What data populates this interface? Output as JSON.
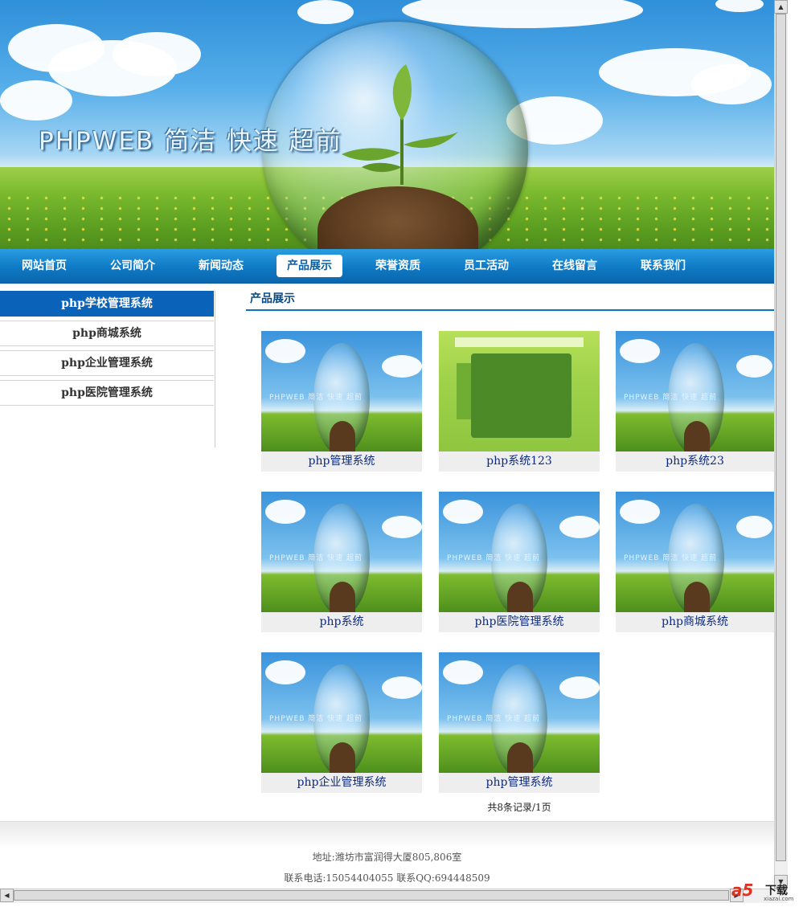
{
  "banner": {
    "title": "PHPWEB 简洁 快速 超前"
  },
  "nav": {
    "items": [
      {
        "label": "网站首页"
      },
      {
        "label": "公司简介"
      },
      {
        "label": "新闻动态"
      },
      {
        "label": "产品展示",
        "active": true
      },
      {
        "label": "荣誉资质"
      },
      {
        "label": "员工活动"
      },
      {
        "label": "在线留言"
      },
      {
        "label": "联系我们"
      }
    ]
  },
  "sidebar": {
    "items": [
      {
        "label": "php学校管理系统",
        "active": true
      },
      {
        "label": "php商城系统"
      },
      {
        "label": "php企业管理系统"
      },
      {
        "label": "php医院管理系统"
      }
    ]
  },
  "content": {
    "title": "产品展示",
    "products": [
      {
        "label": "php管理系统"
      },
      {
        "label": "php系统123"
      },
      {
        "label": "php系统23"
      },
      {
        "label": "php系统"
      },
      {
        "label": "php医院管理系统"
      },
      {
        "label": "php商城系统"
      },
      {
        "label": "php企业管理系统"
      },
      {
        "label": "php管理系统"
      }
    ],
    "pager": "共8条记录/1页"
  },
  "footer": {
    "address": "地址:潍坊市富润得大厦805,806室",
    "contact": "联系电话:15054404055 联系QQ:694448509"
  },
  "watermark": {
    "text": "下载",
    "url": "xiazai.com"
  },
  "colors": {
    "nav": "#0f7ac5",
    "active_side": "#0a63b8",
    "link": "#0c2a80"
  }
}
